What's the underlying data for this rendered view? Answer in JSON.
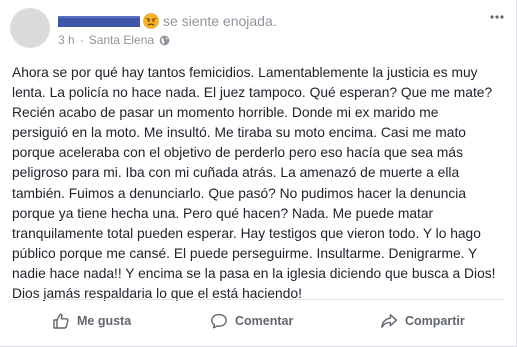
{
  "post": {
    "feeling": "se siente enojada.",
    "time": "3 h",
    "separator": "·",
    "location": "Santa Elena",
    "text_lines": [
      "Ahora se por qué hay tantos femicidios. Lamentablemente la justicia es muy",
      "lenta. La policía no hace nada. El juez tampoco. Qué esperan? Que me mate?",
      "Recién acabo de pasar un momento horrible. Donde mi ex marido me",
      "persiguió en la moto. Me insultó. Me tiraba su moto encima. Casi me mato",
      "porque aceleraba con el objetivo de perderlo pero eso hacía que sea más",
      "peligroso para mi. Iba con mi cuñada atrás. La amenazó de muerte a ella",
      "también. Fuimos a denunciarlo. Que pasó? No pudimos hacer la denuncia",
      "porque ya tiene hecha una. Pero qué hacen? Nada. Me puede matar",
      "tranquilamente total pueden esperar. Hay testigos que vieron todo. Y lo hago",
      "público porque me cansé. El puede perseguirme. Insultarme. Denigrarme. Y",
      "nadie hace nada!! Y encima se la pasa en la iglesia diciendo que busca a Dios!",
      "Dios jamás respaldaria lo que el está haciendo!"
    ]
  },
  "actions": {
    "like_label": "Me gusta",
    "comment_label": "Comentar",
    "share_label": "Compartir"
  },
  "icons": {
    "feeling": "angry-face-icon",
    "privacy": "globe-icon",
    "options": "more-options-icon",
    "like": "thumbs-up-icon",
    "comment": "speech-bubble-icon",
    "share": "share-arrow-icon"
  },
  "colors": {
    "text": "#1d2129",
    "secondary": "#90949c",
    "action": "#606770",
    "author_redaction": "#3f55a8"
  }
}
